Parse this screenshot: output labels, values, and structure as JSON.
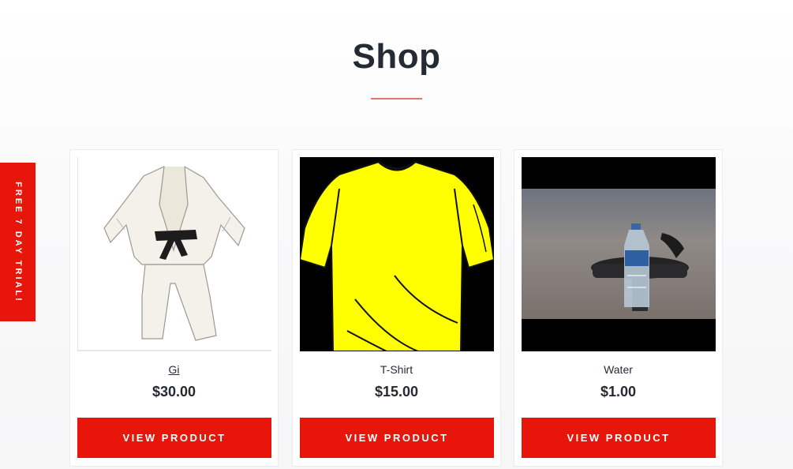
{
  "shop": {
    "title": "Shop"
  },
  "trial_tab": {
    "label": "FREE 7 DAY TRIAL!"
  },
  "products": [
    {
      "name": "Gi",
      "price": "$30.00",
      "button": "VIEW PRODUCT",
      "image": "gi-image"
    },
    {
      "name": "T-Shirt",
      "price": "$15.00",
      "button": "VIEW PRODUCT",
      "image": "tshirt-image"
    },
    {
      "name": "Water",
      "price": "$1.00",
      "button": "VIEW PRODUCT",
      "image": "water-bottle-image"
    }
  ],
  "colors": {
    "accent": "#e8150a",
    "divider": "#e3766c",
    "text": "#252b33",
    "tshirt": "#ffff00"
  }
}
